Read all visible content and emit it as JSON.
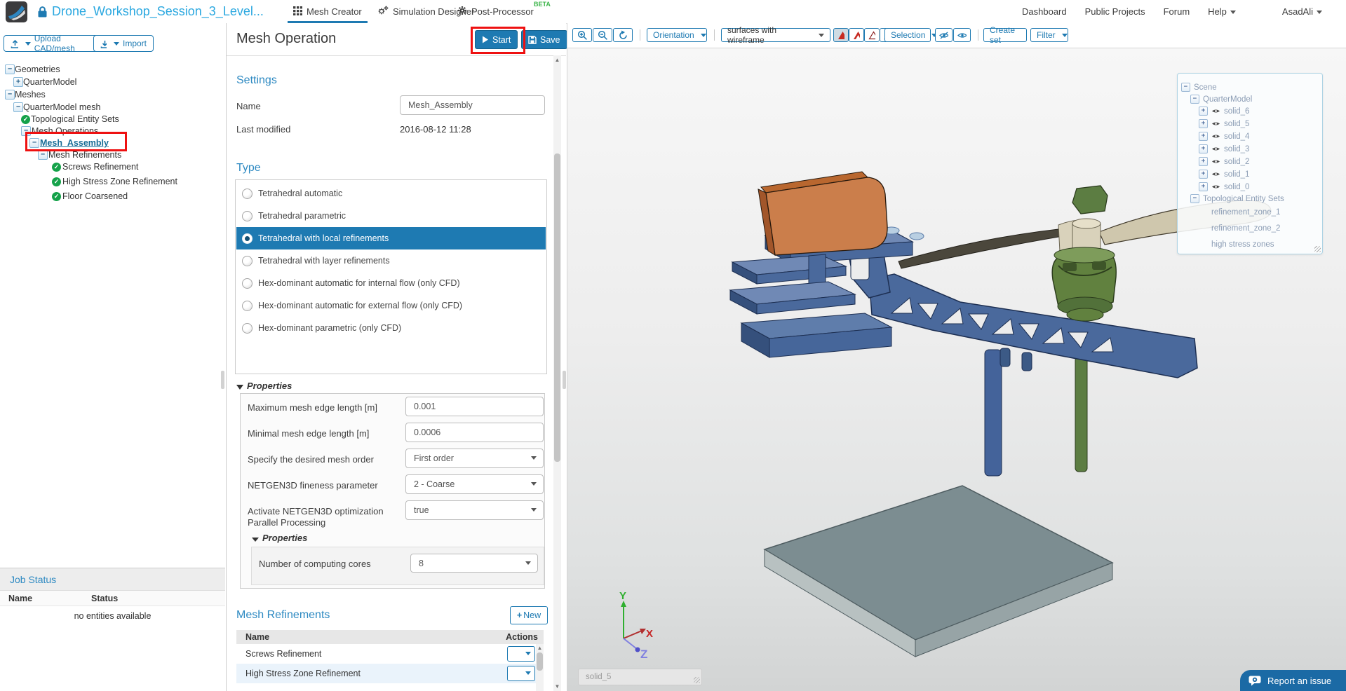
{
  "colors": {
    "accent": "#1e7ab2",
    "title_blue": "#2ba8e0",
    "heading_blue": "#2e8ac2",
    "beta_green": "#3cb54a",
    "check_green": "#15a24a",
    "annotation_red": "#ee1111",
    "selected_row": "#1e7ab2",
    "model_orange": "#c87c49",
    "model_blue": "#4a699c",
    "model_green": "#61813f",
    "floor_gray": "#7c8d91"
  },
  "header": {
    "project_title": "Drone_Workshop_Session_3_Level...",
    "tabs": [
      {
        "label": "Mesh Creator",
        "icon": "grid-icon",
        "active": true,
        "badge": ""
      },
      {
        "label": "Simulation Designer",
        "icon": "gears-icon",
        "active": false,
        "badge": ""
      },
      {
        "label": "Post-Processor",
        "icon": "gear-icon",
        "active": false,
        "badge": "BETA"
      }
    ],
    "nav": [
      "Dashboard",
      "Public Projects",
      "Forum",
      "Help"
    ],
    "user": "AsadAli"
  },
  "sidebar": {
    "upload_button": "Upload CAD/mesh",
    "import_button": "Import",
    "tree": [
      {
        "label": "Geometries",
        "icon": "minus"
      },
      {
        "label": "QuarterModel",
        "icon": "plus"
      },
      {
        "label": "Meshes",
        "icon": "minus"
      },
      {
        "label": "QuarterModel mesh",
        "icon": "minus"
      },
      {
        "label": "Topological Entity Sets",
        "icon": "check"
      },
      {
        "label": "Mesh Operations",
        "icon": "minus"
      },
      {
        "label": "Mesh_Assembly",
        "icon": "minus",
        "selected": true,
        "annotated": true
      },
      {
        "label": "Mesh Refinements",
        "icon": "minus"
      },
      {
        "label": "Screws Refinement",
        "icon": "check"
      },
      {
        "label": "High Stress Zone Refinement",
        "icon": "check"
      },
      {
        "label": "Floor Coarsened",
        "icon": "check"
      }
    ],
    "job_status": {
      "title": "Job Status",
      "columns": [
        "Name",
        "Status"
      ],
      "empty_text": "no entities available"
    }
  },
  "panel": {
    "title": "Mesh Operation",
    "start_button": "Start",
    "save_button": "Save",
    "settings": {
      "heading": "Settings",
      "name_label": "Name",
      "name_value": "Mesh_Assembly",
      "modified_label": "Last modified",
      "modified_value": "2016-08-12 11:28"
    },
    "type": {
      "heading": "Type",
      "selected_index": 2,
      "options": [
        "Tetrahedral automatic",
        "Tetrahedral parametric",
        "Tetrahedral with local refinements",
        "Tetrahedral with layer refinements",
        "Hex-dominant automatic for internal flow (only CFD)",
        "Hex-dominant automatic for external flow (only CFD)",
        "Hex-dominant parametric (only CFD)"
      ]
    },
    "properties": {
      "heading": "Properties",
      "rows": [
        {
          "label": "Maximum mesh edge length [m]",
          "value": "0.001",
          "control": "input"
        },
        {
          "label": "Minimal mesh edge length [m]",
          "value": "0.0006",
          "control": "input"
        },
        {
          "label": "Specify the desired mesh order",
          "value": "First order",
          "control": "select"
        },
        {
          "label": "NETGEN3D fineness parameter",
          "value": "2 - Coarse",
          "control": "select"
        },
        {
          "label": "Activate NETGEN3D optimization",
          "value": "true",
          "control": "select"
        }
      ],
      "parallel_label": "Parallel Processing",
      "sub_heading": "Properties",
      "sub_rows": [
        {
          "label": "Number of computing cores",
          "value": "8",
          "control": "select"
        }
      ]
    },
    "refinements": {
      "heading": "Mesh Refinements",
      "new_button": "New",
      "columns": [
        "Name",
        "Actions"
      ],
      "rows": [
        "Screws Refinement",
        "High Stress Zone Refinement"
      ]
    }
  },
  "viewport": {
    "toolbar": {
      "orientation": "Orientation",
      "display_mode": "surfaces with wireframe",
      "selection": "Selection",
      "create_set": "Create set",
      "filter": "Filter"
    },
    "scene_tree": [
      {
        "label": "Scene",
        "exp": "minus",
        "eye": false
      },
      {
        "label": "QuarterModel",
        "exp": "minus",
        "eye": false
      },
      {
        "label": "solid_6",
        "exp": "plus",
        "eye": true
      },
      {
        "label": "solid_5",
        "exp": "plus",
        "eye": true
      },
      {
        "label": "solid_4",
        "exp": "plus",
        "eye": true
      },
      {
        "label": "solid_3",
        "exp": "plus",
        "eye": true
      },
      {
        "label": "solid_2",
        "exp": "plus",
        "eye": true
      },
      {
        "label": "solid_1",
        "exp": "plus",
        "eye": true
      },
      {
        "label": "solid_0",
        "exp": "plus",
        "eye": true
      },
      {
        "label": "Topological Entity Sets",
        "exp": "minus",
        "eye": false
      },
      {
        "label": "refinement_zone_1",
        "exp": "",
        "eye": false
      },
      {
        "label": "refinement_zone_2",
        "exp": "",
        "eye": false
      },
      {
        "label": "high stress zones",
        "exp": "",
        "eye": false
      }
    ],
    "axis": {
      "x": "X",
      "y": "Y",
      "z": "Z"
    },
    "hover_label": "solid_5",
    "report_button": "Report an issue"
  }
}
